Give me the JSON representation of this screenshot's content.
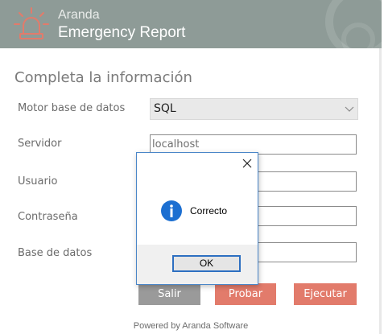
{
  "header": {
    "brand_line1": "Aranda",
    "brand_line2": "Emergency Report",
    "logo_icon": "siren-icon"
  },
  "form": {
    "section_title": "Completa la información",
    "motor": {
      "label": "Motor base de datos",
      "value": "SQL"
    },
    "servidor": {
      "label": "Servidor",
      "value": "localhost"
    },
    "usuario": {
      "label": "Usuario",
      "value": ""
    },
    "contrasena": {
      "label": "Contraseña",
      "value": ""
    },
    "base_datos": {
      "label": "Base de datos",
      "value": ""
    }
  },
  "buttons": {
    "salir": "Salir",
    "probar": "Probar",
    "ejecutar": "Ejecutar"
  },
  "footer": "Powered by Aranda Software",
  "dialog": {
    "message": "Correcto",
    "ok_label": "OK",
    "icon": "info-icon"
  },
  "colors": {
    "header_bg": "#8e9b97",
    "accent": "#e27b6b",
    "salir_bg": "#9a9a9a",
    "dialog_border": "#4a86c8"
  }
}
